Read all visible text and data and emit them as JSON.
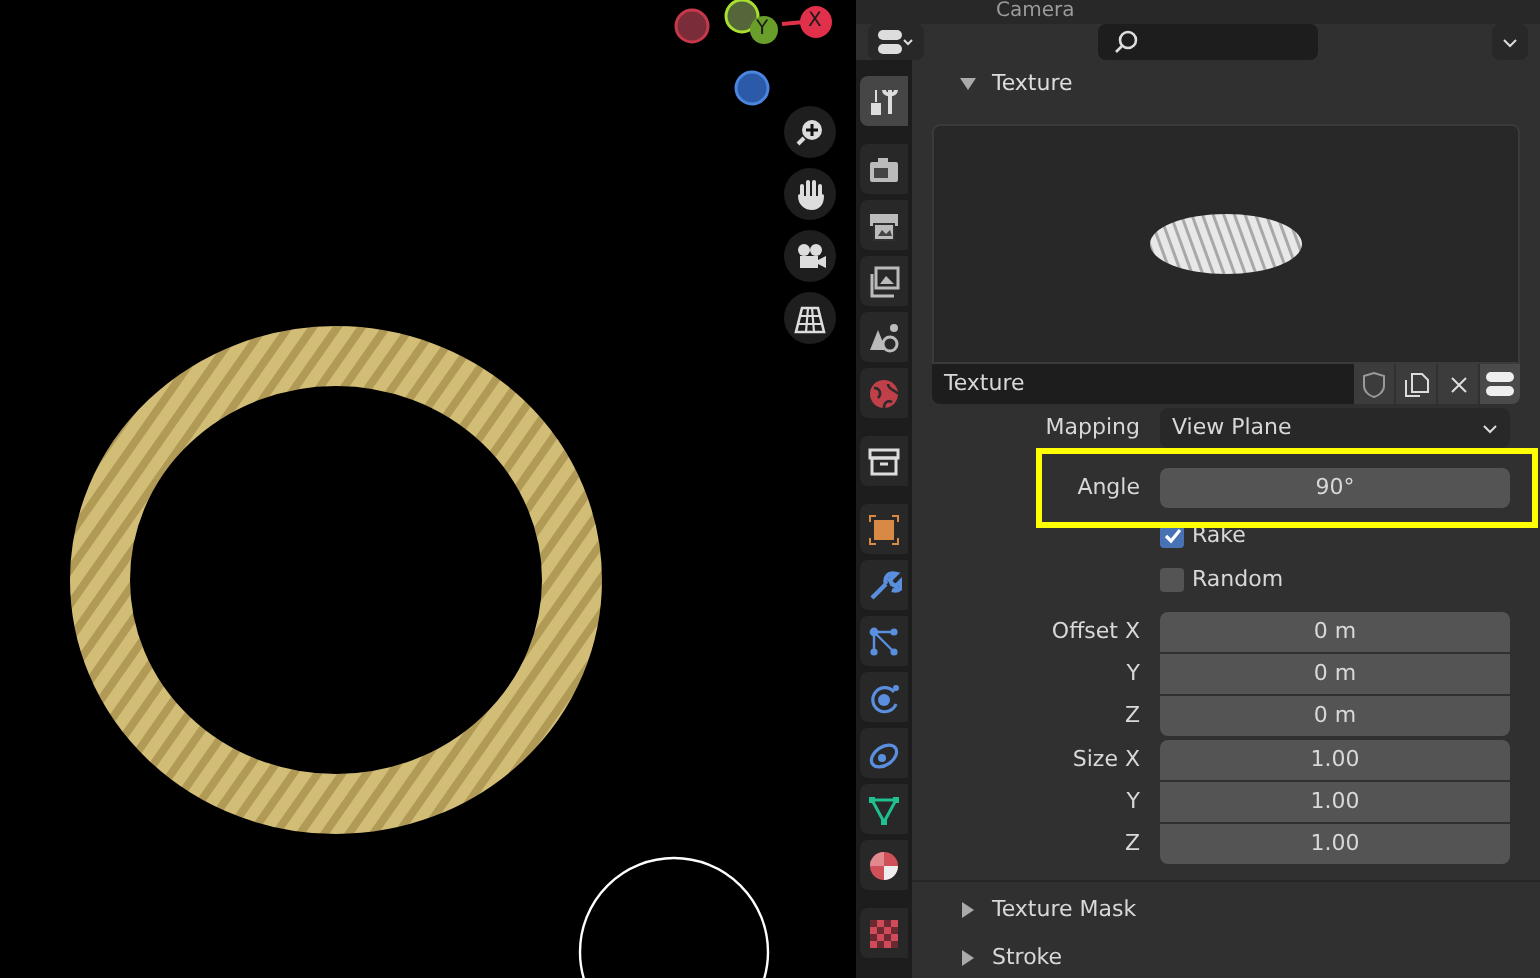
{
  "viewport": {
    "gizmo": {
      "x_label": "X",
      "y_label": "Y"
    },
    "nav_buttons": [
      {
        "kind": "zoom"
      },
      {
        "kind": "pan"
      },
      {
        "kind": "camera"
      },
      {
        "kind": "grid"
      }
    ]
  },
  "outliner": {
    "row_label": "Camera"
  },
  "properties": {
    "tab_groups": [
      [
        {
          "kind": "tool",
          "selected": true
        }
      ],
      [
        {
          "kind": "render",
          "selected": false
        },
        {
          "kind": "output",
          "selected": false
        },
        {
          "kind": "view_layer",
          "selected": false
        },
        {
          "kind": "scene",
          "selected": false
        },
        {
          "kind": "world",
          "selected": false
        }
      ],
      [
        {
          "kind": "collection",
          "selected": false
        }
      ],
      [
        {
          "kind": "object",
          "selected": false
        },
        {
          "kind": "modifiers",
          "selected": false
        },
        {
          "kind": "particles",
          "selected": false
        },
        {
          "kind": "physics",
          "selected": false
        },
        {
          "kind": "constraints",
          "selected": false
        },
        {
          "kind": "data",
          "selected": false
        },
        {
          "kind": "material",
          "selected": false
        }
      ],
      [
        {
          "kind": "texture",
          "selected": false
        }
      ]
    ],
    "texture_panel": {
      "title": "Texture",
      "expanded": true,
      "texture_name": "Texture",
      "mapping": {
        "label": "Mapping",
        "value": "View Plane"
      },
      "angle": {
        "label": "Angle",
        "value": "90°",
        "highlighted": true
      },
      "checkboxes": [
        {
          "label": "Rake",
          "checked": true
        },
        {
          "label": "Random",
          "checked": false
        }
      ],
      "vector_groups": [
        {
          "rows": [
            {
              "label": "Offset X",
              "value": "0 m"
            },
            {
              "label": "Y",
              "value": "0 m"
            },
            {
              "label": "Z",
              "value": "0 m"
            }
          ]
        },
        {
          "rows": [
            {
              "label": "Size X",
              "value": "1.00"
            },
            {
              "label": "Y",
              "value": "1.00"
            },
            {
              "label": "Z",
              "value": "1.00"
            }
          ]
        }
      ]
    },
    "collapsed_panels": [
      {
        "title": "Texture Mask",
        "expanded": false
      },
      {
        "title": "Stroke",
        "expanded": false
      }
    ]
  }
}
